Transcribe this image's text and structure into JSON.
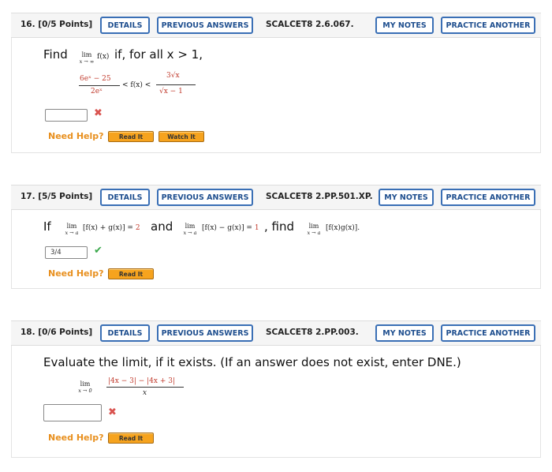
{
  "buttons": {
    "details": "DETAILS",
    "previous_answers": "PREVIOUS ANSWERS",
    "my_notes": "MY NOTES",
    "practice_another": "PRACTICE ANOTHER"
  },
  "help": {
    "need_help": "Need Help?",
    "read_it": "Read It",
    "watch_it": "Watch It"
  },
  "q16": {
    "number": "16.",
    "points": "[0/5 Points]",
    "code": "SCALCET8 2.6.067.",
    "prompt_find": "Find",
    "lim_word": "lim",
    "lim_sub": "x → ∞",
    "lim_func": "f(x)",
    "prompt_rest": "if, for all x > 1,",
    "ineq_left_num": "6eˣ − 25",
    "ineq_left_den": "2eˣ",
    "ineq_mid": "< f(x) <",
    "ineq_right_num": "3√x",
    "ineq_right_den": "√x − 1",
    "answer_value": "",
    "status": "incorrect"
  },
  "q17": {
    "number": "17.",
    "points": "[5/5 Points]",
    "code": "SCALCET8 2.PP.501.XP.",
    "prompt_if": "If",
    "lim_word": "lim",
    "lim_sub": "x → a",
    "expr1": "[f(x) + g(x)] = ",
    "val1": "2",
    "and_word": "and",
    "expr2": "[f(x) − g(x)] = ",
    "val2": "1",
    "find_word": ", find",
    "expr3": "[f(x)g(x)].",
    "answer_value": "3/4",
    "status": "correct"
  },
  "q18": {
    "number": "18.",
    "points": "[0/6 Points]",
    "code": "SCALCET8 2.PP.003.",
    "prompt": "Evaluate the limit, if it exists. (If an answer does not exist, enter DNE.)",
    "lim_word": "lim",
    "lim_sub": "x → 0",
    "numerator": "|4x − 3| − |4x + 3|",
    "denominator": "x",
    "answer_value": "",
    "status": "incorrect"
  }
}
